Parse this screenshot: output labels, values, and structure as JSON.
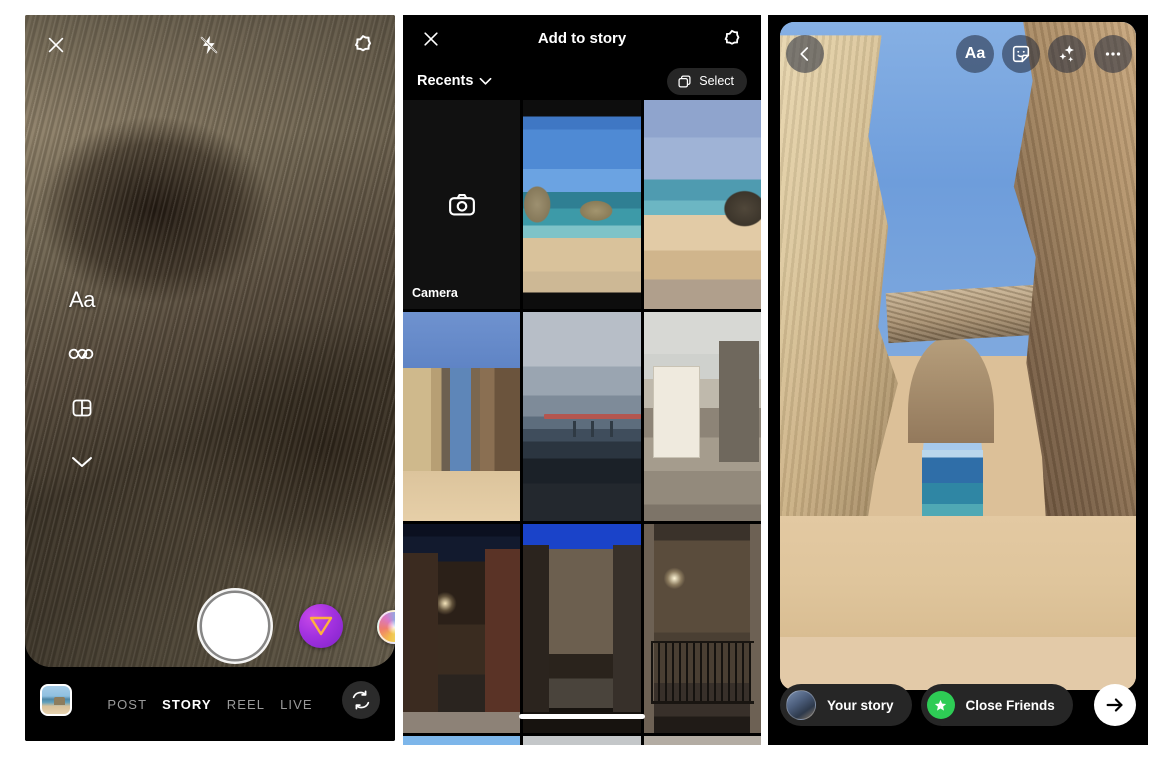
{
  "panels": {
    "camera": {
      "name": "Instagram camera",
      "topbar": {
        "close": "close-icon",
        "flash": "flash-off-icon",
        "settings": "settings-gear-icon"
      },
      "tools": [
        {
          "name": "text-tool",
          "label": "Aa",
          "icon": "text-aa-icon"
        },
        {
          "name": "boomerang-tool",
          "label": "",
          "icon": "infinity-icon"
        },
        {
          "name": "layout-tool",
          "label": "",
          "icon": "layout-grid-icon"
        },
        {
          "name": "more-tools",
          "label": "",
          "icon": "chevron-down-icon"
        }
      ],
      "shutter_label": "",
      "filters": [
        {
          "name": "filter-triangle",
          "color": "#a332e0"
        },
        {
          "name": "filter-rainbow",
          "color": "#e9e07a"
        }
      ],
      "gallery_thumb": "recent-photo-thumbnail",
      "modes": [
        {
          "label": "POST",
          "active": false
        },
        {
          "label": "STORY",
          "active": true
        },
        {
          "label": "REEL",
          "active": false
        },
        {
          "label": "LIVE",
          "active": false
        }
      ],
      "flip_camera": "flip-camera-icon"
    },
    "gallery": {
      "title": "Add to story",
      "close": "close-icon",
      "settings": "settings-gear-icon",
      "album": "Recents",
      "album_chevron": "chevron-down-icon",
      "select_label": "Select",
      "select_icon": "multi-select-icon",
      "camera_tile": {
        "label": "Camera",
        "icon": "camera-icon"
      },
      "items": [
        {
          "name": "photo-beach-rock",
          "alt": "Beach with rock formation in the sea"
        },
        {
          "name": "photo-beach-cliff",
          "alt": "Sandy beach beside a dark cliff"
        },
        {
          "name": "photo-rock-arch",
          "alt": "Rock arch over a beach"
        },
        {
          "name": "photo-forth-bridge",
          "alt": "Forth Bridge over the water"
        },
        {
          "name": "photo-cobbled-street",
          "alt": "Cobbled street with white house"
        },
        {
          "name": "photo-night-alley",
          "alt": "Narrow alley at night"
        },
        {
          "name": "photo-night-square",
          "alt": "Lit building at night"
        },
        {
          "name": "photo-night-balcony",
          "alt": "Iron balcony lit by a street lamp"
        },
        {
          "name": "photo-partial-sky",
          "alt": "Partially visible sky photo"
        },
        {
          "name": "photo-partial-grey",
          "alt": "Partially visible grey photo"
        },
        {
          "name": "photo-partial-stone",
          "alt": "Partially visible stone photo"
        }
      ]
    },
    "story": {
      "back": "back-chevron-icon",
      "tools": [
        {
          "name": "text-tool",
          "label": "Aa",
          "icon": "text-aa-icon"
        },
        {
          "name": "sticker-tool",
          "label": "",
          "icon": "sticker-smiley-icon"
        },
        {
          "name": "effects-tool",
          "label": "",
          "icon": "sparkles-icon"
        },
        {
          "name": "more-options",
          "label": "",
          "icon": "ellipsis-icon"
        }
      ],
      "photo_alt": "Rock arch over a beach with the sea beyond",
      "your_story_label": "Your story",
      "close_friends_label": "Close Friends",
      "close_friends_color": "#2ecc55",
      "send": "send-arrow-icon",
      "avatar": "user-avatar"
    }
  }
}
